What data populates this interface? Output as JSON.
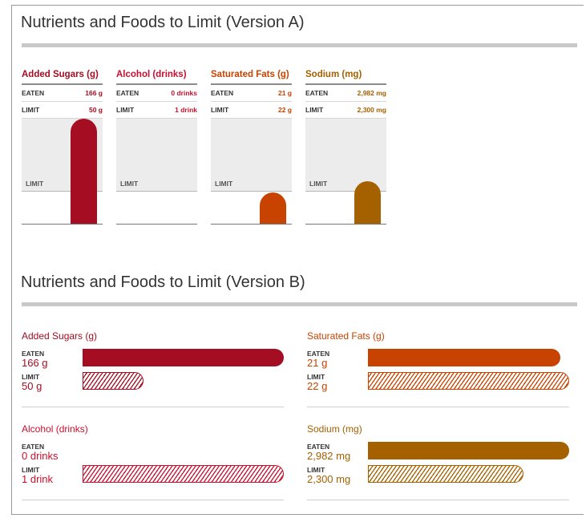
{
  "version_a": {
    "title": "Nutrients and Foods to Limit (Version A)",
    "eaten_label": "EATEN",
    "limit_label": "LIMIT",
    "limit_line_label": "LIMIT"
  },
  "version_b": {
    "title": "Nutrients and Foods to Limit (Version B)",
    "eaten_label": "EATEN",
    "limit_label": "LIMIT"
  },
  "chart_data": [
    {
      "type": "bar",
      "title": "Nutrients and Foods to Limit (Version A)",
      "orientation": "vertical",
      "grid": false,
      "series": [
        {
          "name": "Added Sugars (g)",
          "eaten": 166,
          "limit": 50,
          "eaten_text": "166 g",
          "limit_text": "50 g",
          "color": "#a50d22"
        },
        {
          "name": "Alcohol (drinks)",
          "eaten": 0,
          "limit": 1,
          "eaten_text": "0 drinks",
          "limit_text": "1 drink",
          "color": "#c8102e"
        },
        {
          "name": "Saturated Fats (g)",
          "eaten": 21,
          "limit": 22,
          "eaten_text": "21 g",
          "limit_text": "22 g",
          "color": "#c84200"
        },
        {
          "name": "Sodium (mg)",
          "eaten": 2982,
          "limit": 2300,
          "eaten_text": "2,982 mg",
          "limit_text": "2,300 mg",
          "color": "#a56000"
        }
      ]
    },
    {
      "type": "bar",
      "title": "Nutrients and Foods to Limit (Version B)",
      "orientation": "horizontal",
      "grid": false,
      "series": [
        {
          "name": "Added Sugars (g)",
          "eaten": 166,
          "limit": 50,
          "eaten_text": "166 g",
          "limit_text": "50 g",
          "color": "#a50d22"
        },
        {
          "name": "Saturated Fats (g)",
          "eaten": 21,
          "limit": 22,
          "eaten_text": "21 g",
          "limit_text": "22 g",
          "color": "#c84200"
        },
        {
          "name": "Alcohol (drinks)",
          "eaten": 0,
          "limit": 1,
          "eaten_text": "0 drinks",
          "limit_text": "1 drink",
          "color": "#c8102e"
        },
        {
          "name": "Sodium (mg)",
          "eaten": 2982,
          "limit": 2300,
          "eaten_text": "2,982 mg",
          "limit_text": "2,300 mg",
          "color": "#a56000"
        }
      ]
    }
  ]
}
